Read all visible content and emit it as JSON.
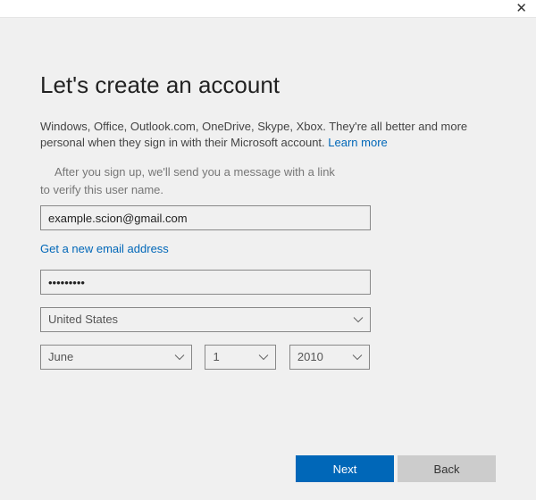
{
  "title": "Let's create an account",
  "description_prefix": "Windows, Office, Outlook.com, OneDrive, Skype, Xbox. They're all better and more personal when they sign in with their Microsoft account. ",
  "learn_more": "Learn more",
  "verify_line1": "After you sign up, we'll send you a message with a link",
  "verify_line2": "to verify this user name.",
  "email_value": "example.scion@gmail.com",
  "new_email_link": "Get a new email address",
  "password_value": "•••••••••",
  "country_value": "United States",
  "dob": {
    "month": "June",
    "day": "1",
    "year": "2010"
  },
  "buttons": {
    "next": "Next",
    "back": "Back"
  }
}
